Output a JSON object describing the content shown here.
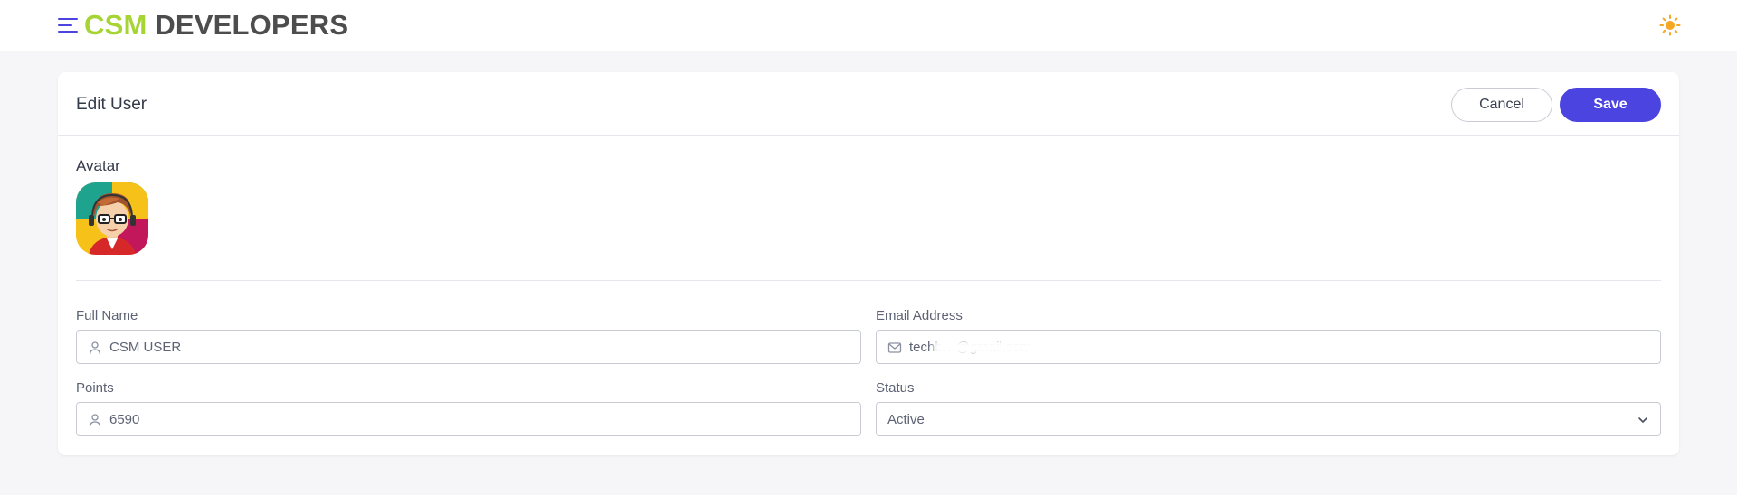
{
  "header": {
    "brand_part1": "CSM",
    "brand_part2": "DEVELOPERS",
    "menu_icon": "hamburger-menu-icon",
    "theme_icon": "sun-icon",
    "accent_color": "#a6d435",
    "brand_dark_color": "#4d4d4d",
    "theme_icon_color": "#f5a623"
  },
  "page": {
    "title": "Edit User",
    "cancel_label": "Cancel",
    "save_label": "Save",
    "primary_color": "#4c44e0"
  },
  "avatar": {
    "label": "Avatar"
  },
  "form": {
    "full_name": {
      "label": "Full Name",
      "value": "CSM USER",
      "icon": "user-icon"
    },
    "email": {
      "label": "Email Address",
      "value": "techb…@gmail.com",
      "icon": "mail-icon"
    },
    "points": {
      "label": "Points",
      "value": "6590",
      "icon": "user-icon"
    },
    "status": {
      "label": "Status",
      "value": "Active",
      "icon": "chevron-down-icon"
    }
  }
}
